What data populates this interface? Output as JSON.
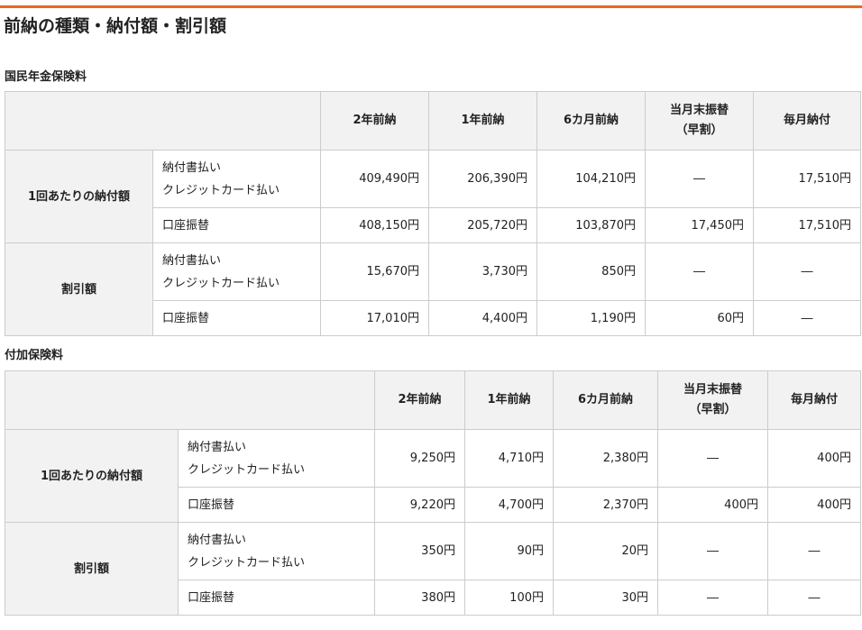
{
  "colors": {
    "accent": "#e86a1f",
    "header_bg": "#f2f2f2",
    "border": "#cccccc"
  },
  "page_title": "前納の種類・納付額・割引額",
  "sections": [
    {
      "title": "国民年金保険料",
      "headers": [
        "2年前納",
        "1年前納",
        "6カ月前納",
        "当月末振替\n（早割）",
        "毎月納付"
      ],
      "groups": [
        {
          "label": "1回あたりの納付額",
          "rows": [
            {
              "method": "納付書払い\nクレジットカード払い",
              "values": [
                "409,490円",
                "206,390円",
                "104,210円",
                "―",
                "17,510円"
              ]
            },
            {
              "method": "口座振替",
              "values": [
                "408,150円",
                "205,720円",
                "103,870円",
                "17,450円",
                "17,510円"
              ]
            }
          ]
        },
        {
          "label": "割引額",
          "rows": [
            {
              "method": "納付書払い\nクレジットカード払い",
              "values": [
                "15,670円",
                "3,730円",
                "850円",
                "―",
                "―"
              ]
            },
            {
              "method": "口座振替",
              "values": [
                "17,010円",
                "4,400円",
                "1,190円",
                "60円",
                "―"
              ]
            }
          ]
        }
      ]
    },
    {
      "title": "付加保険料",
      "headers": [
        "2年前納",
        "1年前納",
        "6カ月前納",
        "当月末振替\n（早割）",
        "毎月納付"
      ],
      "groups": [
        {
          "label": "1回あたりの納付額",
          "rows": [
            {
              "method": "納付書払い\nクレジットカード払い",
              "values": [
                "9,250円",
                "4,710円",
                "2,380円",
                "―",
                "400円"
              ]
            },
            {
              "method": "口座振替",
              "values": [
                "9,220円",
                "4,700円",
                "2,370円",
                "400円",
                "400円"
              ]
            }
          ]
        },
        {
          "label": "割引額",
          "rows": [
            {
              "method": "納付書払い\nクレジットカード払い",
              "values": [
                "350円",
                "90円",
                "20円",
                "―",
                "―"
              ]
            },
            {
              "method": "口座振替",
              "values": [
                "380円",
                "100円",
                "30円",
                "―",
                "―"
              ]
            }
          ]
        }
      ]
    }
  ]
}
